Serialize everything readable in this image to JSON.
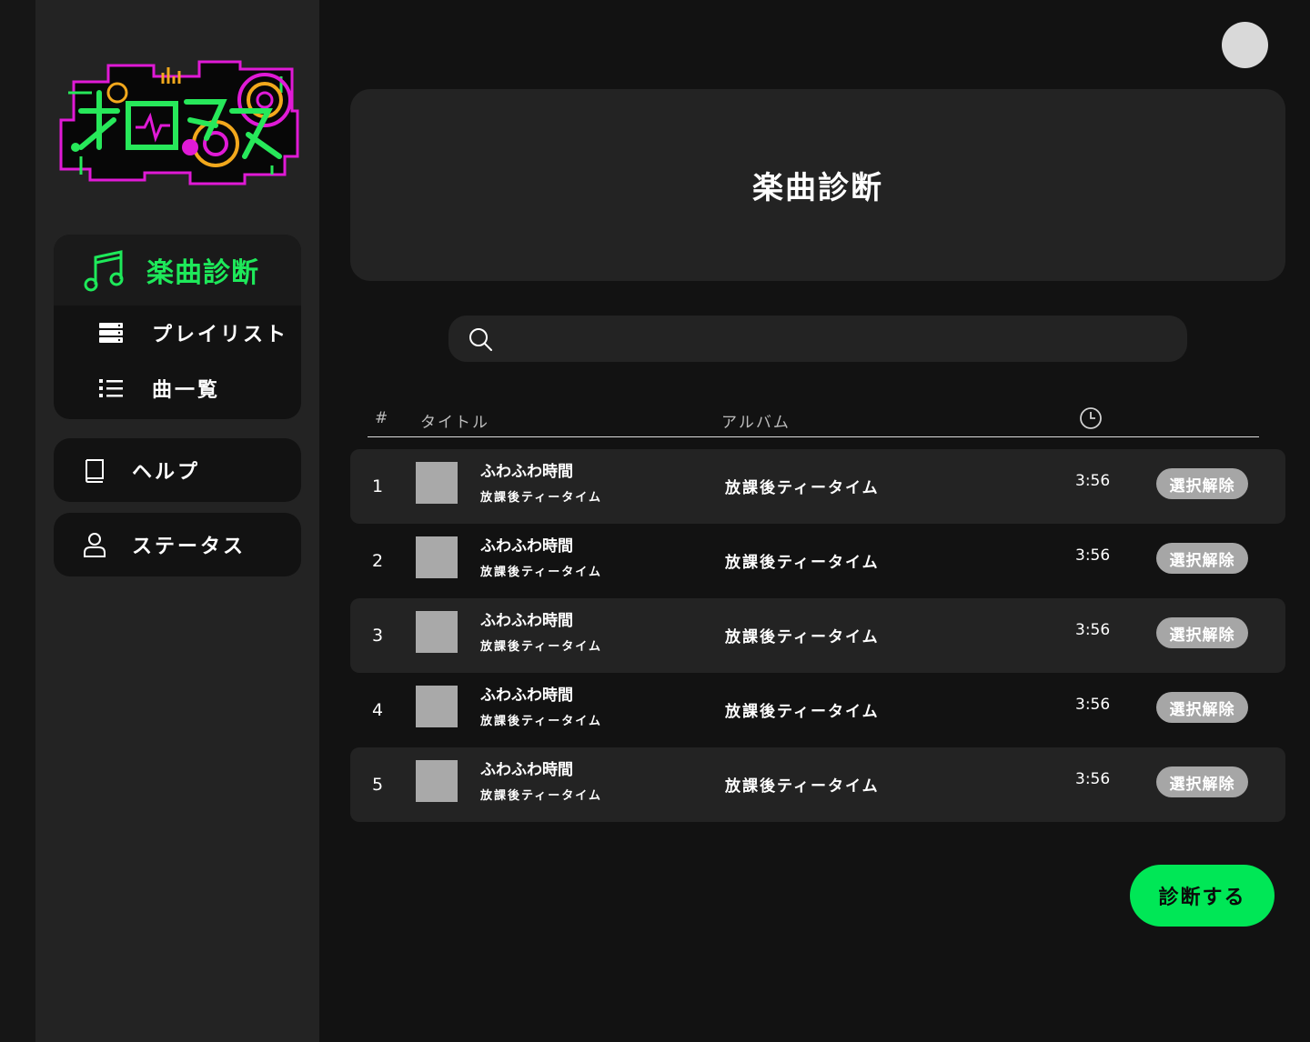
{
  "app": {
    "logo_text": "メロタス"
  },
  "sidebar": {
    "active": {
      "label": "楽曲診断",
      "icon": "music-note-icon"
    },
    "sub_items": [
      {
        "label": "プレイリスト",
        "icon": "playlist-icon"
      },
      {
        "label": "曲一覧",
        "icon": "list-icon"
      }
    ],
    "cards": [
      {
        "label": "ヘルプ",
        "icon": "book-icon"
      },
      {
        "label": "ステータス",
        "icon": "user-icon"
      }
    ]
  },
  "header": {
    "title": "楽曲診断"
  },
  "search": {
    "placeholder": "",
    "value": "",
    "icon": "search-icon"
  },
  "table": {
    "columns": {
      "num": "#",
      "title": "タイトル",
      "album": "アルバム",
      "duration_icon": "clock-icon"
    },
    "rows": [
      {
        "num": "1",
        "title": "ふわふわ時間",
        "artist": "放課後ティータイム",
        "album": "放課後ティータイム",
        "duration": "3:56",
        "action": "選択解除"
      },
      {
        "num": "2",
        "title": "ふわふわ時間",
        "artist": "放課後ティータイム",
        "album": "放課後ティータイム",
        "duration": "3:56",
        "action": "選択解除"
      },
      {
        "num": "3",
        "title": "ふわふわ時間",
        "artist": "放課後ティータイム",
        "album": "放課後ティータイム",
        "duration": "3:56",
        "action": "選択解除"
      },
      {
        "num": "4",
        "title": "ふわふわ時間",
        "artist": "放課後ティータイム",
        "album": "放課後ティータイム",
        "duration": "3:56",
        "action": "選択解除"
      },
      {
        "num": "5",
        "title": "ふわふわ時間",
        "artist": "放課後ティータイム",
        "album": "放課後ティータイム",
        "duration": "3:56",
        "action": "選択解除"
      }
    ]
  },
  "actions": {
    "diagnose_label": "診断する"
  },
  "colors": {
    "accent": "#00e756",
    "nav_active_text": "#1ee95a",
    "background": "#121212",
    "panel": "#232323",
    "thumbnail": "#a9a9a9",
    "deselect_button": "#a6a6a6"
  }
}
